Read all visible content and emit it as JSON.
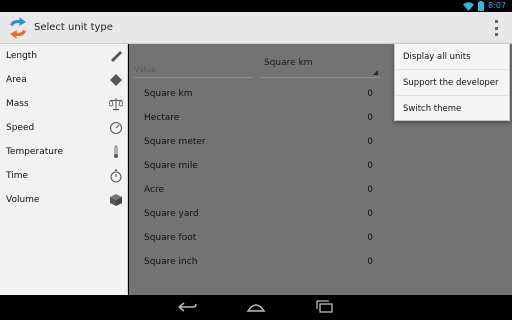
{
  "status_bar": {
    "time": "8:07"
  },
  "action_bar": {
    "title": "Select unit type",
    "overflow_icon": "overflow-icon",
    "app_icon": "swap-arrows-icon"
  },
  "sidebar": {
    "items": [
      {
        "label": "Length",
        "icon": "ruler-icon"
      },
      {
        "label": "Area",
        "icon": "area-icon"
      },
      {
        "label": "Mass",
        "icon": "scale-icon"
      },
      {
        "label": "Speed",
        "icon": "speedometer-icon"
      },
      {
        "label": "Temperature",
        "icon": "thermometer-icon"
      },
      {
        "label": "Time",
        "icon": "stopwatch-icon"
      },
      {
        "label": "Volume",
        "icon": "cube-icon"
      }
    ]
  },
  "main": {
    "value_placeholder": "Value",
    "selected_unit": "Square km",
    "rows": [
      {
        "unit": "Square km",
        "value": "0"
      },
      {
        "unit": "Hectare",
        "value": "0"
      },
      {
        "unit": "Square meter",
        "value": "0"
      },
      {
        "unit": "Square mile",
        "value": "0"
      },
      {
        "unit": "Acre",
        "value": "0"
      },
      {
        "unit": "Square yard",
        "value": "0"
      },
      {
        "unit": "Square foot",
        "value": "0"
      },
      {
        "unit": "Square inch",
        "value": "0"
      }
    ]
  },
  "menu": {
    "items": [
      {
        "label": "Display all units"
      },
      {
        "label": "Support the developer"
      },
      {
        "label": "Switch theme"
      }
    ]
  },
  "colors": {
    "accent": "#33b5e5",
    "action_bar": "#e8e8e8",
    "dim_overlay": "#737373"
  }
}
